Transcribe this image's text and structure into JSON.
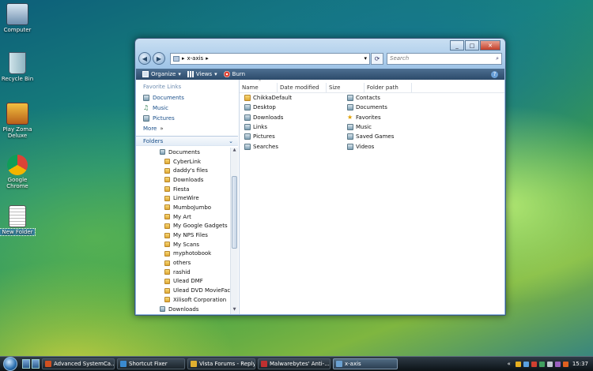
{
  "desktop": {
    "icons": [
      {
        "label": "Computer"
      },
      {
        "label": "Recycle Bin"
      },
      {
        "label": "Play Zoma Deluxe"
      },
      {
        "label": "Google Chrome"
      },
      {
        "label": "New Folder"
      }
    ]
  },
  "window": {
    "address": {
      "segment": "x-axis"
    },
    "search_placeholder": "Search",
    "toolbar": {
      "organize": "Organize",
      "views": "Views",
      "burn": "Burn",
      "help": "?"
    },
    "favorites": {
      "title": "Favorite Links",
      "items": [
        "Documents",
        "Music",
        "Pictures"
      ],
      "more": "More"
    },
    "folders_label": "Folders",
    "tree": {
      "root": "Documents",
      "children": [
        "CyberLink",
        "daddy's files",
        "Downloads",
        "Fiesta",
        "LimeWire",
        "MumboJumbo",
        "My Art",
        "My Google Gadgets",
        "My NPS Files",
        "My Scans",
        "myphotobook",
        "others",
        "rashid",
        "Ulead DMF",
        "Ulead DVD MovieFactor",
        "Xilisoft Corporation"
      ],
      "next": "Downloads"
    },
    "columns": [
      "Name",
      "Date modified",
      "Size",
      "Folder path"
    ],
    "files_left": [
      "ChikkaDefault",
      "Desktop",
      "Downloads",
      "Links",
      "Pictures",
      "Searches"
    ],
    "files_right": [
      "Contacts",
      "Documents",
      "Favorites",
      "Music",
      "Saved Games",
      "Videos"
    ]
  },
  "taskbar": {
    "buttons": [
      "Advanced SystemCa...",
      "Shortcut Fixer",
      "Vista Forums - Reply...",
      "Malwarebytes' Anti-...",
      "x-axis"
    ],
    "clock": "15:37"
  }
}
